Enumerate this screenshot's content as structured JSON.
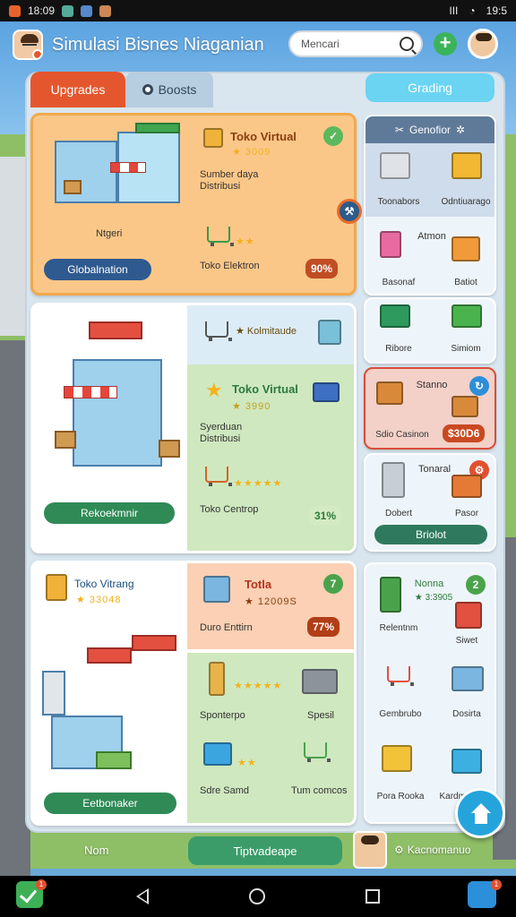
{
  "status_bar": {
    "time_left": "18:09",
    "battery": "III",
    "time_right": "19:5",
    "right_signal": "◔"
  },
  "header": {
    "title": "Simulasi Bisnes  Niaganian",
    "search_placeholder": "Mencari",
    "add_label": "+"
  },
  "tabs": {
    "upgrades": "Upgrades",
    "boosts": "Boosts",
    "shop": "Grading"
  },
  "card1": {
    "title": "Toko Virtual",
    "price": "★ 3009",
    "desc": "Sumber daya\nDistribusi",
    "item_label": "Ntgeri",
    "cart_label": "Toko Elektron",
    "button": "Globalnation",
    "percent": "90%",
    "badge": "✓"
  },
  "card2": {
    "header_label": "★ Kolmitaude",
    "title": "Toko Virtual",
    "price": "★ 3990",
    "desc": "Syerduan\nDistribusi",
    "button": "Rekoekmnir",
    "cart_label": "Toko Centrop",
    "percent": "31%"
  },
  "card3": {
    "left_title": "Toko Vitrang",
    "left_price": "★ 33048",
    "right_title": "Totla",
    "right_price": "★ 12009S",
    "right_desc": "Duro Enttirn",
    "percent": "77%",
    "badge": "7",
    "label_a": "Sponterpo",
    "label_b": "Spesil",
    "label_c": "Sdre Samd",
    "label_d": "Tum comcos",
    "button": "Eetbonaker"
  },
  "right1": {
    "header": "Genofior",
    "items": [
      "Toonabors",
      "Odntiuarago",
      "Atmon",
      "Basonaf",
      "Batiot",
      "Ribore",
      "Simiom"
    ]
  },
  "right2": {
    "title": "Stanno",
    "label": "Sdio Casinon",
    "value": "$30D6"
  },
  "right3": {
    "title": "Tonaral",
    "label_a": "Dobert",
    "label_b": "Pasor",
    "button": "Briolot"
  },
  "right4": {
    "title": "Nonna",
    "price": "★ 3:3905",
    "items": [
      "Relentnm",
      "Siwet",
      "Gembrubo",
      "Dosirta",
      "Pora Rooka",
      "Kardmo"
    ]
  },
  "bottom": {
    "home": "Nom",
    "upgrade": "Tiptvadeape",
    "achievements": "Kacnomanuo"
  }
}
